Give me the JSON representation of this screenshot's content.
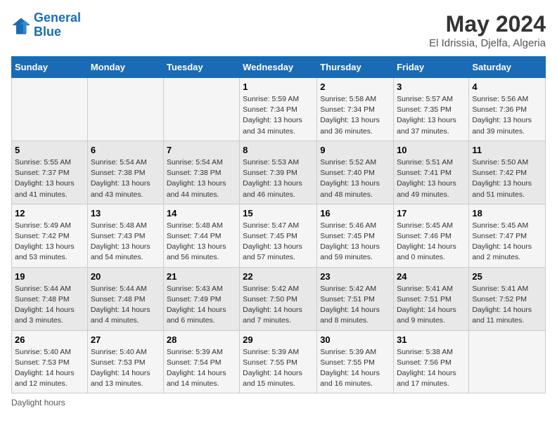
{
  "header": {
    "logo_line1": "General",
    "logo_line2": "Blue",
    "main_title": "May 2024",
    "subtitle": "El Idrissia, Djelfa, Algeria"
  },
  "calendar": {
    "days_of_week": [
      "Sunday",
      "Monday",
      "Tuesday",
      "Wednesday",
      "Thursday",
      "Friday",
      "Saturday"
    ],
    "weeks": [
      [
        {
          "day": "",
          "info": ""
        },
        {
          "day": "",
          "info": ""
        },
        {
          "day": "",
          "info": ""
        },
        {
          "day": "1",
          "info": "Sunrise: 5:59 AM\nSunset: 7:34 PM\nDaylight: 13 hours\nand 34 minutes."
        },
        {
          "day": "2",
          "info": "Sunrise: 5:58 AM\nSunset: 7:34 PM\nDaylight: 13 hours\nand 36 minutes."
        },
        {
          "day": "3",
          "info": "Sunrise: 5:57 AM\nSunset: 7:35 PM\nDaylight: 13 hours\nand 37 minutes."
        },
        {
          "day": "4",
          "info": "Sunrise: 5:56 AM\nSunset: 7:36 PM\nDaylight: 13 hours\nand 39 minutes."
        }
      ],
      [
        {
          "day": "5",
          "info": "Sunrise: 5:55 AM\nSunset: 7:37 PM\nDaylight: 13 hours\nand 41 minutes."
        },
        {
          "day": "6",
          "info": "Sunrise: 5:54 AM\nSunset: 7:38 PM\nDaylight: 13 hours\nand 43 minutes."
        },
        {
          "day": "7",
          "info": "Sunrise: 5:54 AM\nSunset: 7:38 PM\nDaylight: 13 hours\nand 44 minutes."
        },
        {
          "day": "8",
          "info": "Sunrise: 5:53 AM\nSunset: 7:39 PM\nDaylight: 13 hours\nand 46 minutes."
        },
        {
          "day": "9",
          "info": "Sunrise: 5:52 AM\nSunset: 7:40 PM\nDaylight: 13 hours\nand 48 minutes."
        },
        {
          "day": "10",
          "info": "Sunrise: 5:51 AM\nSunset: 7:41 PM\nDaylight: 13 hours\nand 49 minutes."
        },
        {
          "day": "11",
          "info": "Sunrise: 5:50 AM\nSunset: 7:42 PM\nDaylight: 13 hours\nand 51 minutes."
        }
      ],
      [
        {
          "day": "12",
          "info": "Sunrise: 5:49 AM\nSunset: 7:42 PM\nDaylight: 13 hours\nand 53 minutes."
        },
        {
          "day": "13",
          "info": "Sunrise: 5:48 AM\nSunset: 7:43 PM\nDaylight: 13 hours\nand 54 minutes."
        },
        {
          "day": "14",
          "info": "Sunrise: 5:48 AM\nSunset: 7:44 PM\nDaylight: 13 hours\nand 56 minutes."
        },
        {
          "day": "15",
          "info": "Sunrise: 5:47 AM\nSunset: 7:45 PM\nDaylight: 13 hours\nand 57 minutes."
        },
        {
          "day": "16",
          "info": "Sunrise: 5:46 AM\nSunset: 7:45 PM\nDaylight: 13 hours\nand 59 minutes."
        },
        {
          "day": "17",
          "info": "Sunrise: 5:45 AM\nSunset: 7:46 PM\nDaylight: 14 hours\nand 0 minutes."
        },
        {
          "day": "18",
          "info": "Sunrise: 5:45 AM\nSunset: 7:47 PM\nDaylight: 14 hours\nand 2 minutes."
        }
      ],
      [
        {
          "day": "19",
          "info": "Sunrise: 5:44 AM\nSunset: 7:48 PM\nDaylight: 14 hours\nand 3 minutes."
        },
        {
          "day": "20",
          "info": "Sunrise: 5:44 AM\nSunset: 7:48 PM\nDaylight: 14 hours\nand 4 minutes."
        },
        {
          "day": "21",
          "info": "Sunrise: 5:43 AM\nSunset: 7:49 PM\nDaylight: 14 hours\nand 6 minutes."
        },
        {
          "day": "22",
          "info": "Sunrise: 5:42 AM\nSunset: 7:50 PM\nDaylight: 14 hours\nand 7 minutes."
        },
        {
          "day": "23",
          "info": "Sunrise: 5:42 AM\nSunset: 7:51 PM\nDaylight: 14 hours\nand 8 minutes."
        },
        {
          "day": "24",
          "info": "Sunrise: 5:41 AM\nSunset: 7:51 PM\nDaylight: 14 hours\nand 9 minutes."
        },
        {
          "day": "25",
          "info": "Sunrise: 5:41 AM\nSunset: 7:52 PM\nDaylight: 14 hours\nand 11 minutes."
        }
      ],
      [
        {
          "day": "26",
          "info": "Sunrise: 5:40 AM\nSunset: 7:53 PM\nDaylight: 14 hours\nand 12 minutes."
        },
        {
          "day": "27",
          "info": "Sunrise: 5:40 AM\nSunset: 7:53 PM\nDaylight: 14 hours\nand 13 minutes."
        },
        {
          "day": "28",
          "info": "Sunrise: 5:39 AM\nSunset: 7:54 PM\nDaylight: 14 hours\nand 14 minutes."
        },
        {
          "day": "29",
          "info": "Sunrise: 5:39 AM\nSunset: 7:55 PM\nDaylight: 14 hours\nand 15 minutes."
        },
        {
          "day": "30",
          "info": "Sunrise: 5:39 AM\nSunset: 7:55 PM\nDaylight: 14 hours\nand 16 minutes."
        },
        {
          "day": "31",
          "info": "Sunrise: 5:38 AM\nSunset: 7:56 PM\nDaylight: 14 hours\nand 17 minutes."
        },
        {
          "day": "",
          "info": ""
        }
      ]
    ]
  },
  "footer": {
    "text": "Daylight hours"
  }
}
